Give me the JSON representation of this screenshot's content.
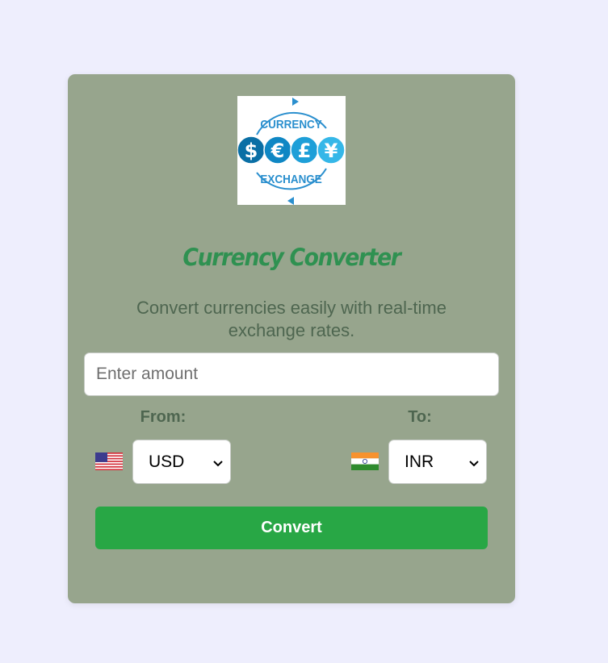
{
  "logo": {
    "top_text": "CURRENCY",
    "bottom_text": "EXCHANGE",
    "symbols": [
      "$",
      "€",
      "£",
      "¥"
    ],
    "colors": [
      "#0a6fa5",
      "#0f87c4",
      "#1e9fd8",
      "#35b7e8"
    ]
  },
  "title": "Currency Converter",
  "subtitle": "Convert currencies easily with real-time exchange rates.",
  "amount": {
    "placeholder": "Enter amount",
    "value": ""
  },
  "from": {
    "label": "From:",
    "currency": "USD",
    "flag": "us-flag-icon"
  },
  "to": {
    "label": "To:",
    "currency": "INR",
    "flag": "india-flag-icon"
  },
  "convert_button": "Convert",
  "colors": {
    "page_background": "#eeeefd",
    "card_background": "#97a58d",
    "title": "#2f9151",
    "text": "#4e6650",
    "button": "#28a745"
  }
}
